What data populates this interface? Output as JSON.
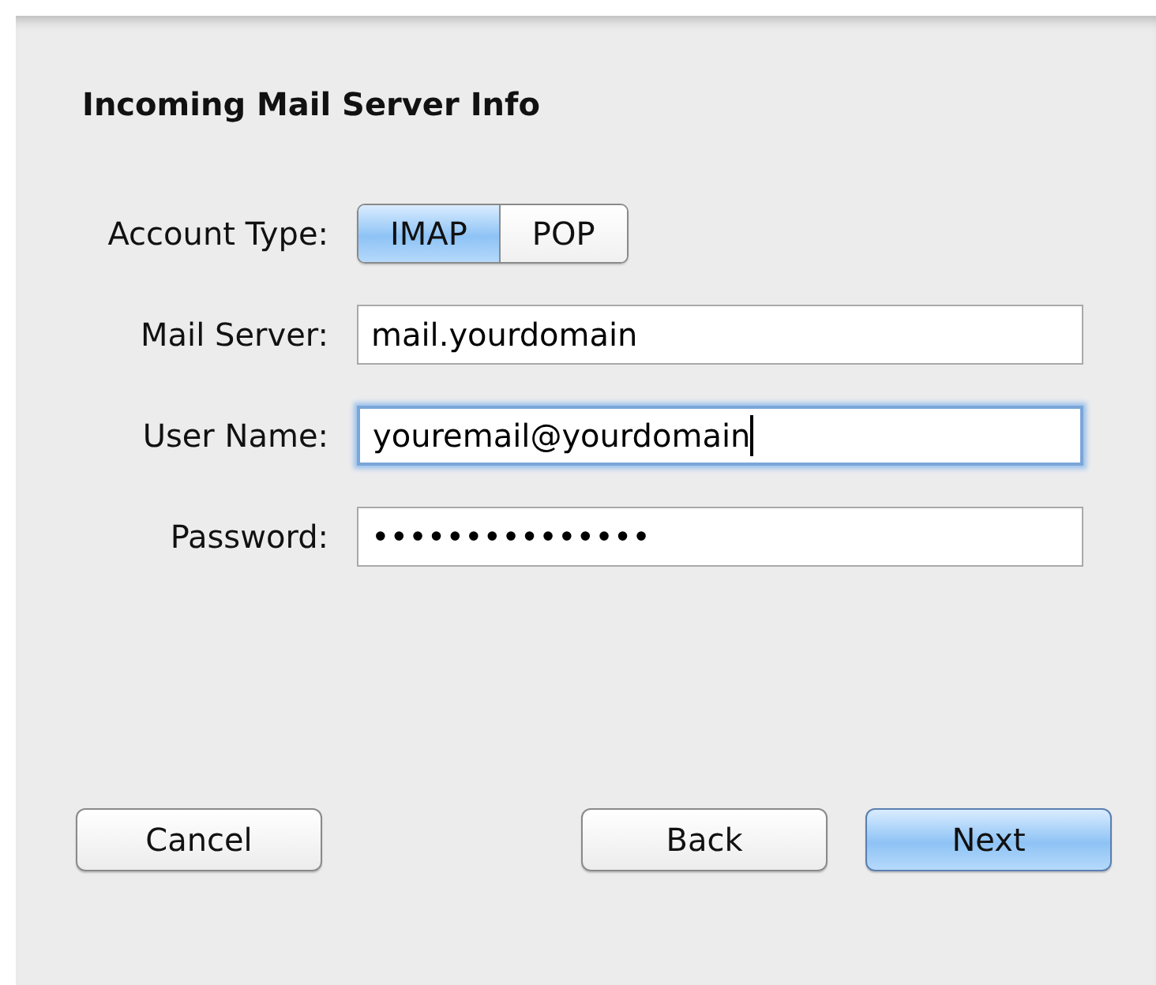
{
  "sheet": {
    "title": "Incoming Mail Server Info"
  },
  "account_type": {
    "label": "Account Type:",
    "options": [
      {
        "label": "IMAP",
        "selected": true
      },
      {
        "label": "POP",
        "selected": false
      }
    ]
  },
  "fields": [
    {
      "label": "Mail Server:",
      "value": "mail.yourdomain",
      "focused": false
    },
    {
      "label": "User Name:",
      "value": "youremail@yourdomain",
      "focused": true
    },
    {
      "label": "Password:",
      "value": "•••••••••••••••",
      "focused": false
    }
  ],
  "buttons": [
    {
      "label": "Cancel",
      "kind": "normal"
    },
    {
      "label": "Back",
      "kind": "normal"
    },
    {
      "label": "Next",
      "kind": "default"
    }
  ]
}
